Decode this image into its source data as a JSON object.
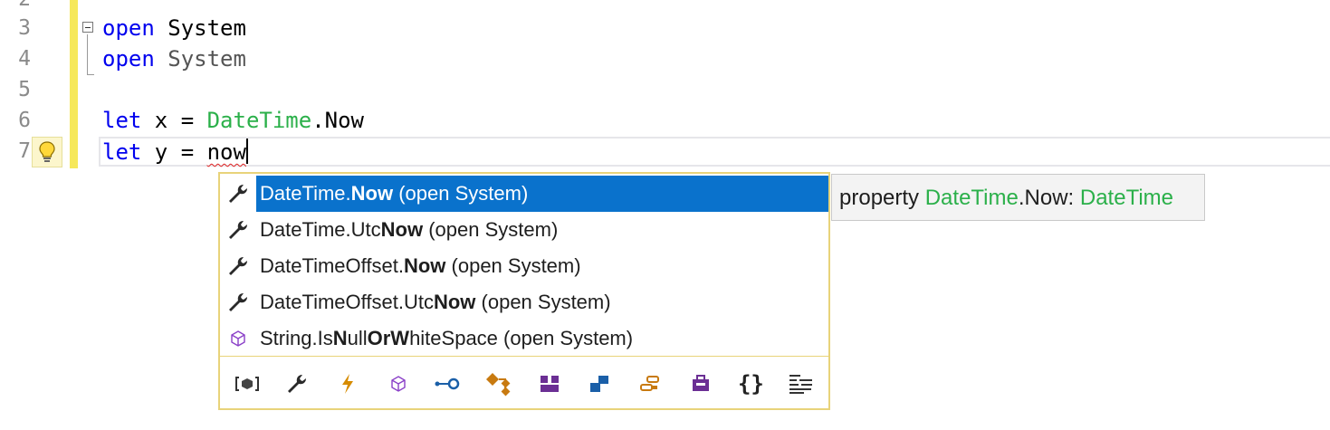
{
  "editor": {
    "line_numbers": [
      "2",
      "3",
      "4",
      "5",
      "6",
      "7"
    ],
    "lines": {
      "l3": {
        "kw": "open",
        "rest": " System"
      },
      "l4": {
        "kw": "open",
        "rest": " System"
      },
      "l6": {
        "kw": "let",
        "mid": " x = ",
        "type": "DateTime",
        "rest": ".Now"
      },
      "l7": {
        "kw": "let",
        "mid": " y = ",
        "typed": "now"
      }
    }
  },
  "completion": {
    "items": [
      {
        "prefix": "DateTime.",
        "bold": "Now",
        "suffix": " (open System)",
        "icon": "wrench-icon",
        "selected": true
      },
      {
        "prefix": "DateTime.Utc",
        "bold": "Now",
        "suffix": " (open System)",
        "icon": "wrench-icon",
        "selected": false
      },
      {
        "prefix": "DateTimeOffset.",
        "bold": "Now",
        "suffix": " (open System)",
        "icon": "wrench-icon",
        "selected": false
      },
      {
        "prefix": "DateTimeOffset.Utc",
        "bold": "Now",
        "suffix": " (open System)",
        "icon": "wrench-icon",
        "selected": false
      }
    ],
    "item5": {
      "p1": "String.Is",
      "b1": "N",
      "p2": "ull",
      "b2": "Or",
      "p3": "",
      "b3": "W",
      "p4": "hiteSpace",
      "suffix": " (open System)",
      "icon": "cube-icon"
    },
    "filters": [
      "namespace-filter-icon",
      "property-filter-icon",
      "event-filter-icon",
      "method-filter-icon",
      "interface-filter-icon",
      "class-filter-icon",
      "struct-filter-icon",
      "enum-filter-icon",
      "field-filter-icon",
      "module-filter-icon",
      "braces-filter-icon",
      "snippet-filter-icon"
    ],
    "filter_braces_label": "{}"
  },
  "tooltip": {
    "kind": "property ",
    "type": "DateTime",
    "member": ".Now: ",
    "return_type": "DateTime"
  },
  "colors": {
    "keyword": "#0000ee",
    "type": "#2bb04a",
    "selection": "#0a72cc",
    "popup_border": "#e8d37a"
  }
}
